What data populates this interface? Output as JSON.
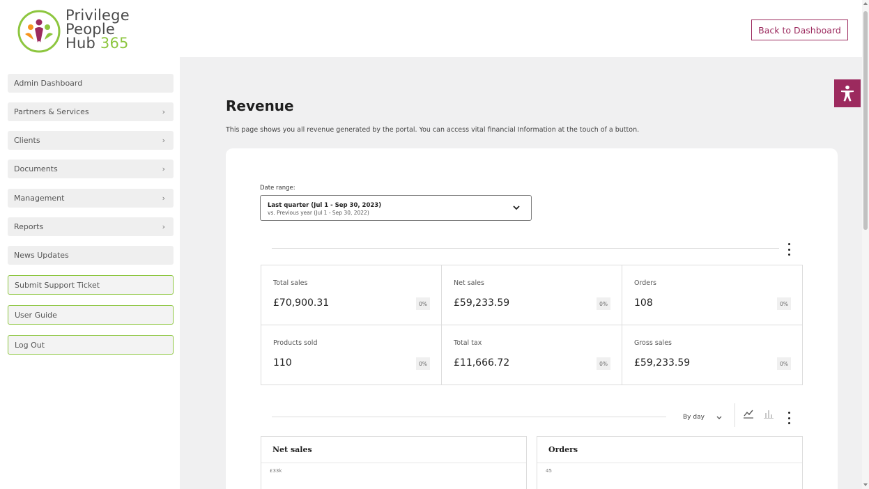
{
  "brand": {
    "line1": "Privilege",
    "line2": "People",
    "line3_word": "Hub",
    "line3_num": "365"
  },
  "header": {
    "back_button": "Back to Dashboard"
  },
  "sidebar": {
    "items": [
      {
        "label": "Admin Dashboard",
        "chevron": ""
      },
      {
        "label": "Partners & Services",
        "chevron": "›"
      },
      {
        "label": "Clients",
        "chevron": "›"
      },
      {
        "label": "Documents",
        "chevron": "›"
      },
      {
        "label": "Management",
        "chevron": "›"
      },
      {
        "label": "Reports",
        "chevron": "›"
      },
      {
        "label": "News Updates",
        "chevron": ""
      },
      {
        "label": "Submit Support Ticket",
        "chevron": ""
      },
      {
        "label": "User Guide",
        "chevron": ""
      },
      {
        "label": "Log Out",
        "chevron": ""
      }
    ]
  },
  "page": {
    "title": "Revenue",
    "description": "This page shows you all revenue generated by the portal. You can access vital financial Information at the touch of a button."
  },
  "date_range": {
    "label": "Date range:",
    "current": "Last quarter (Jul 1 - Sep 30, 2023)",
    "compare": "vs. Previous year (Jul 1 - Sep 30, 2022)"
  },
  "stats": [
    {
      "label": "Total sales",
      "value": "£70,900.31",
      "delta": "0%"
    },
    {
      "label": "Net sales",
      "value": "£59,233.59",
      "delta": "0%"
    },
    {
      "label": "Orders",
      "value": "108",
      "delta": "0%"
    },
    {
      "label": "Products sold",
      "value": "110",
      "delta": "0%"
    },
    {
      "label": "Total tax",
      "value": "£11,666.72",
      "delta": "0%"
    },
    {
      "label": "Gross sales",
      "value": "£59,233.59",
      "delta": "0%"
    }
  ],
  "chart_controls": {
    "interval": "By day"
  },
  "charts": [
    {
      "title": "Net sales",
      "top_tick": "£33k"
    },
    {
      "title": "Orders",
      "top_tick": "45"
    }
  ],
  "colors": {
    "accent": "#9c2a5e",
    "brand_green": "#8dc63f",
    "main_bg": "#f0f0f1"
  },
  "icons": [
    "accessibility-icon",
    "chevron-down-icon",
    "kebab-menu-icon",
    "line-chart-icon",
    "bar-chart-icon",
    "chevron-right-icon"
  ]
}
